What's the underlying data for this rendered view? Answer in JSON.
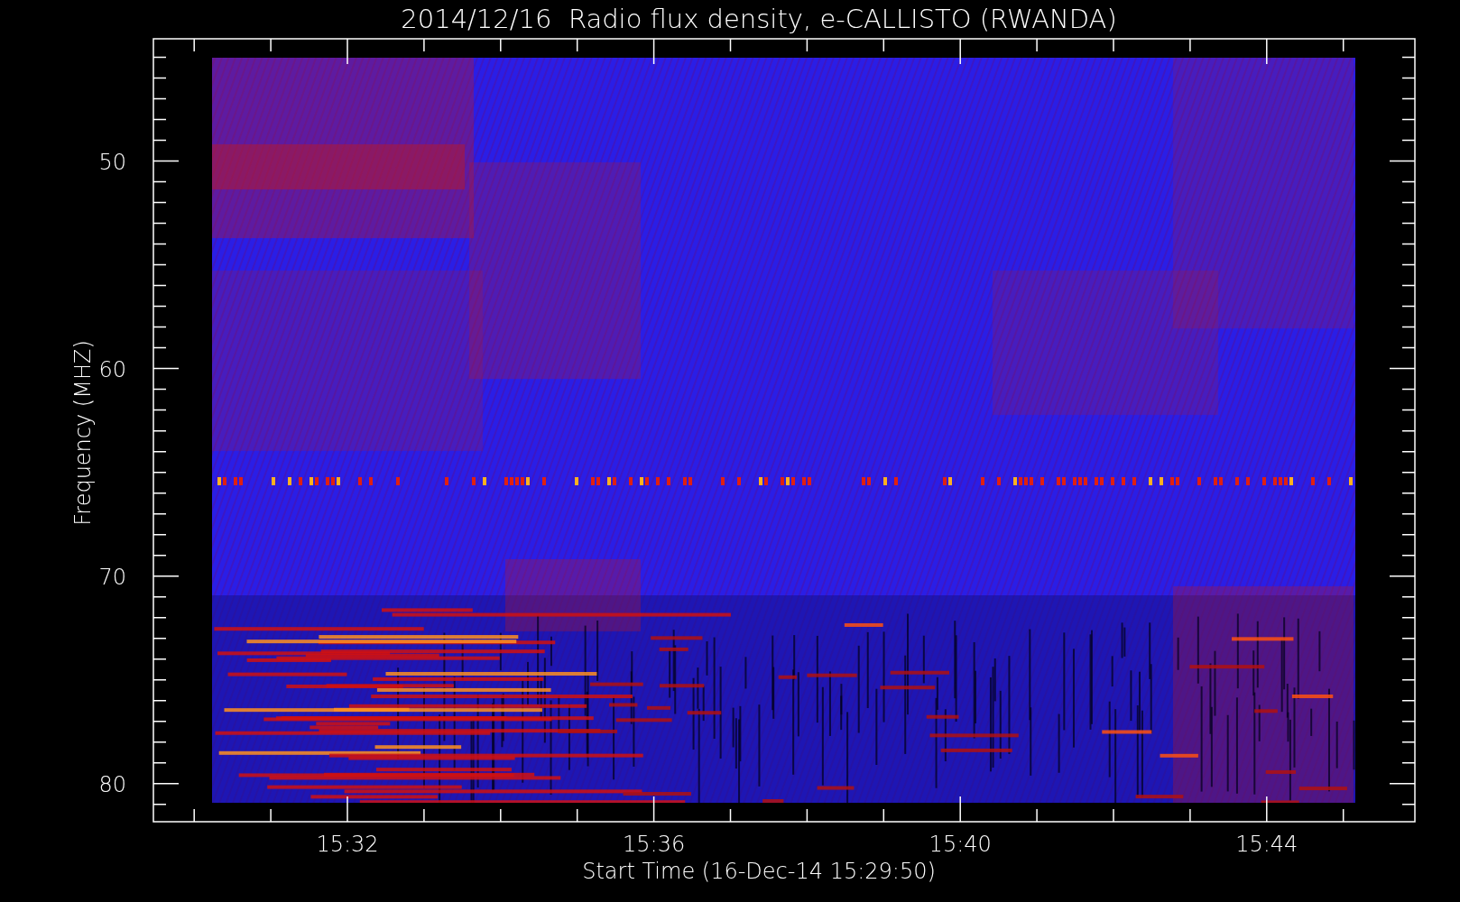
{
  "title": "2014/12/16  Radio flux density, e-CALLISTO (RWANDA)",
  "y_axis": {
    "label": "Frequency (MHZ)",
    "ticks": [
      "50",
      "60",
      "70",
      "80"
    ]
  },
  "x_axis": {
    "label": "Start Time (16-Dec-14 15:29:50)",
    "ticks": [
      "15:32",
      "15:36",
      "15:40",
      "15:44"
    ]
  }
}
